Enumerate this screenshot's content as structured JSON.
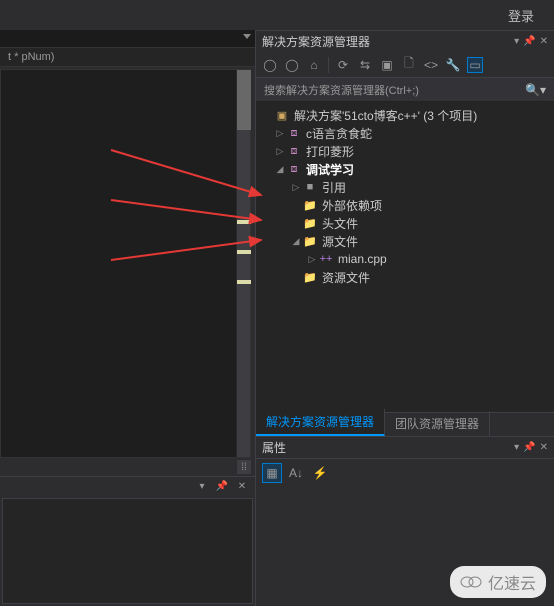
{
  "top": {
    "login": "登录"
  },
  "editor": {
    "label": "t * pNum)"
  },
  "solution_explorer": {
    "title": "解决方案资源管理器",
    "search_placeholder": "搜索解决方案资源管理器(Ctrl+;)",
    "toolbar_icons": [
      "back",
      "forward",
      "home",
      "refresh",
      "sync",
      "collapse",
      "show-all",
      "properties",
      "view-code",
      "preview"
    ],
    "tree": [
      {
        "indent": 0,
        "arrow": "",
        "icon": "solution",
        "iconClass": "ic-solution",
        "label": "解决方案'51cto博客c++' (3 个项目)",
        "bold": false,
        "name": "solution-node"
      },
      {
        "indent": 1,
        "arrow": "▷",
        "icon": "project",
        "iconClass": "ic-project",
        "label": "c语言贪食蛇",
        "bold": false,
        "name": "project-node-snake"
      },
      {
        "indent": 1,
        "arrow": "▷",
        "icon": "project",
        "iconClass": "ic-project",
        "label": "打印菱形",
        "bold": false,
        "name": "project-node-diamond"
      },
      {
        "indent": 1,
        "arrow": "◢",
        "icon": "project",
        "iconClass": "ic-project",
        "label": "调试学习",
        "bold": true,
        "name": "project-node-debug"
      },
      {
        "indent": 2,
        "arrow": "▷",
        "icon": "ref",
        "iconClass": "ic-ref",
        "label": "引用",
        "bold": false,
        "name": "references-node"
      },
      {
        "indent": 2,
        "arrow": "",
        "icon": "folder",
        "iconClass": "ic-folder",
        "label": "外部依赖项",
        "bold": false,
        "name": "external-deps-node"
      },
      {
        "indent": 2,
        "arrow": "",
        "icon": "folder",
        "iconClass": "ic-folder",
        "label": "头文件",
        "bold": false,
        "name": "header-folder-node"
      },
      {
        "indent": 2,
        "arrow": "◢",
        "icon": "folder",
        "iconClass": "ic-folder",
        "label": "源文件",
        "bold": false,
        "name": "source-folder-node"
      },
      {
        "indent": 3,
        "arrow": "▷",
        "icon": "cpp",
        "iconClass": "ic-cpp",
        "label": "mian.cpp",
        "bold": false,
        "name": "file-node-mian-cpp"
      },
      {
        "indent": 2,
        "arrow": "",
        "icon": "folder",
        "iconClass": "ic-folder",
        "label": "资源文件",
        "bold": false,
        "name": "resource-folder-node"
      }
    ],
    "tabs": {
      "active": "解决方案资源管理器",
      "other": "团队资源管理器"
    }
  },
  "properties": {
    "title": "属性"
  },
  "watermark": {
    "text": "亿速云"
  }
}
